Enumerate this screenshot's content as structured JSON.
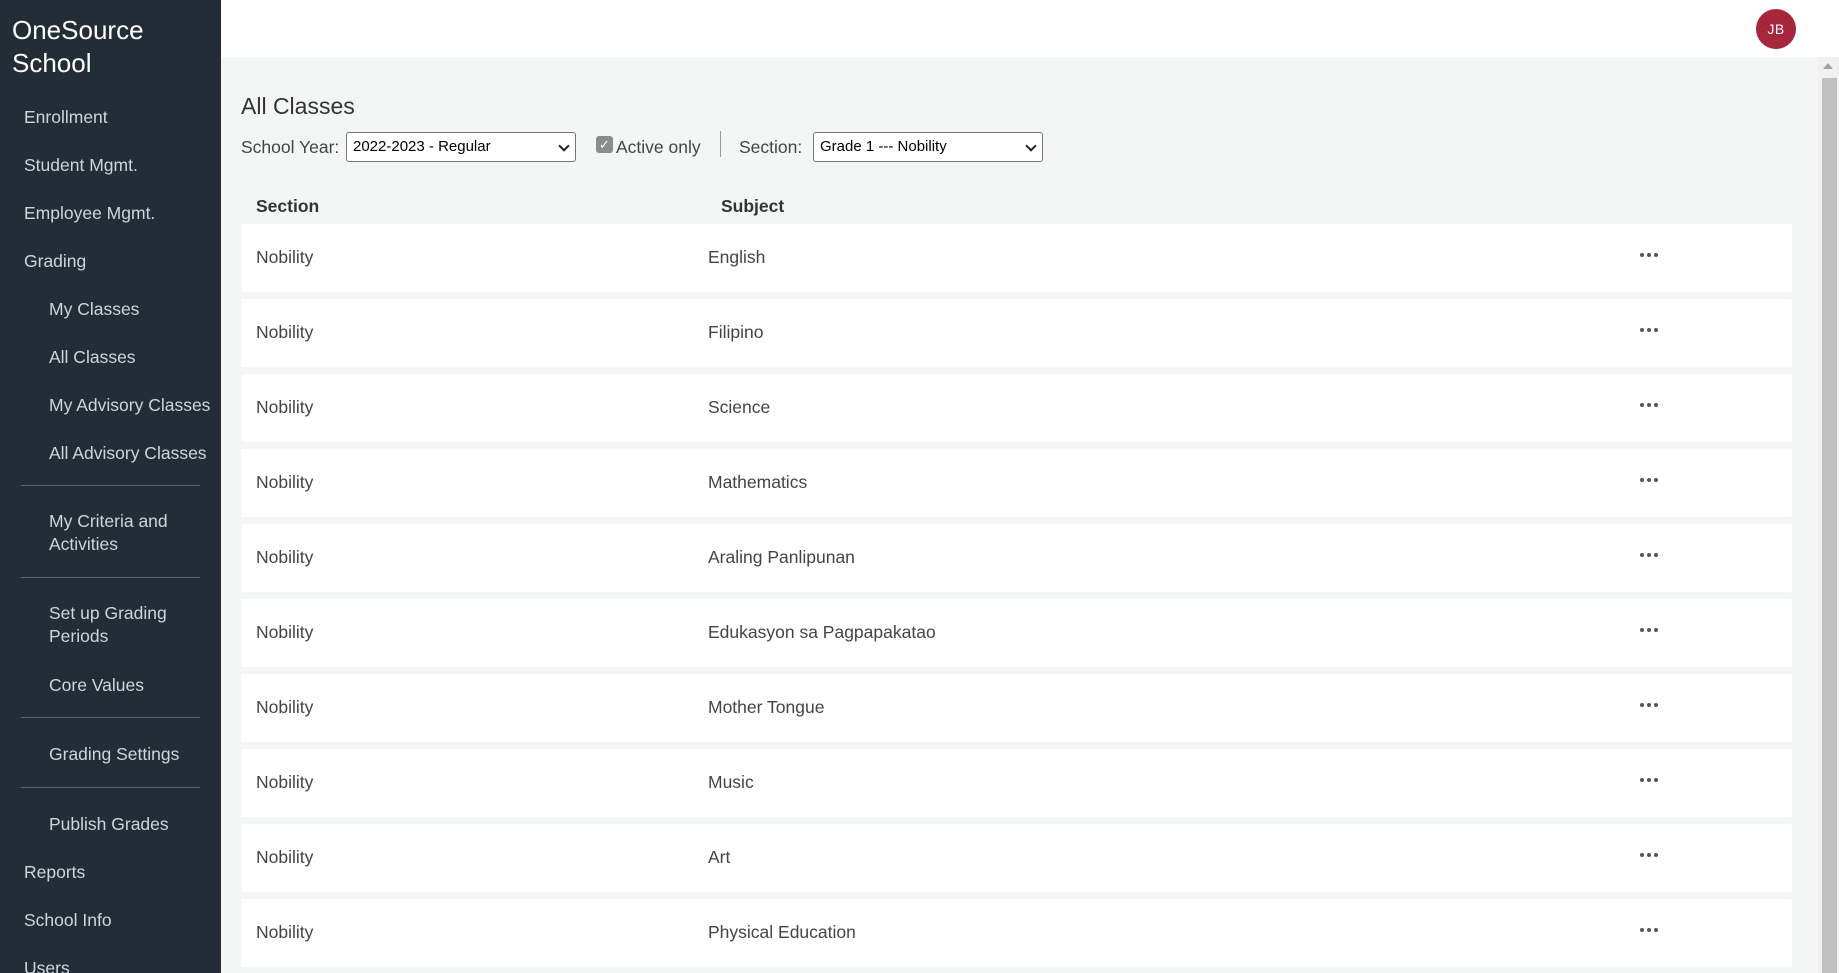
{
  "app": {
    "brand": "OneSource School"
  },
  "sidebar": {
    "enrollment": "Enrollment",
    "student_mgmt": "Student Mgmt.",
    "employee_mgmt": "Employee Mgmt.",
    "grading": "Grading",
    "my_classes": "My Classes",
    "all_classes": "All Classes",
    "my_advisory": "My Advisory Classes",
    "all_advisory": "All Advisory Classes",
    "criteria": "My Criteria and Activities",
    "grading_periods": "Set up Grading Periods",
    "core_values": "Core Values",
    "grading_settings": "Grading Settings",
    "publish_grades": "Publish Grades",
    "reports": "Reports",
    "school_info": "School Info",
    "users": "Users"
  },
  "user": {
    "initials": "JB",
    "avatar_color": "#a8263b"
  },
  "page": {
    "title": "All Classes",
    "filters": {
      "school_year_label": "School Year:",
      "school_year_value": "2022-2023 - Regular",
      "active_only_label": "Active only",
      "active_only_checked": true,
      "section_label": "Section:",
      "section_value": "Grade 1 --- Nobility"
    },
    "table": {
      "headers": {
        "section": "Section",
        "subject": "Subject"
      },
      "rows": [
        {
          "section": "Nobility",
          "subject": "English"
        },
        {
          "section": "Nobility",
          "subject": "Filipino"
        },
        {
          "section": "Nobility",
          "subject": "Science"
        },
        {
          "section": "Nobility",
          "subject": "Mathematics"
        },
        {
          "section": "Nobility",
          "subject": "Araling Panlipunan"
        },
        {
          "section": "Nobility",
          "subject": "Edukasyon sa Pagpapakatao"
        },
        {
          "section": "Nobility",
          "subject": "Mother Tongue"
        },
        {
          "section": "Nobility",
          "subject": "Music"
        },
        {
          "section": "Nobility",
          "subject": "Art"
        },
        {
          "section": "Nobility",
          "subject": "Physical Education"
        }
      ]
    }
  },
  "icons": {
    "row_actions": "more-horizontal-icon",
    "select_arrow": "chevron-down-icon",
    "checkbox": "check-icon"
  }
}
